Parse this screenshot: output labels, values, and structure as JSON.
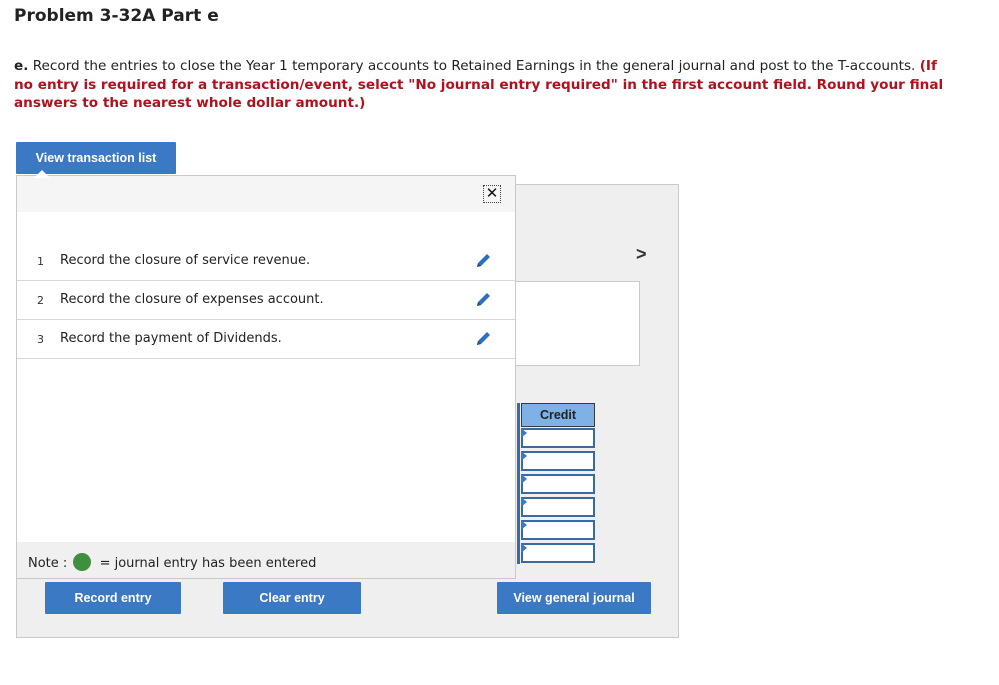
{
  "page": {
    "title": "Problem 3-32A Part e"
  },
  "instructions": {
    "lead": "e.",
    "text": "Record the entries to close the Year 1 temporary accounts to Retained Earnings in the general journal and post to the T-accounts.",
    "emphasis": "(If no entry is required for a transaction/event, select \"No journal entry required\" in the first account field. Round your final answers to the nearest whole dollar amount.)"
  },
  "buttons": {
    "view_transaction_list": "View transaction list",
    "record_entry": "Record entry",
    "clear_entry": "Clear entry",
    "view_general_journal": "View general journal"
  },
  "transactions": [
    {
      "number": "1",
      "label": "Record the closure of service revenue."
    },
    {
      "number": "2",
      "label": "Record the closure of expenses account."
    },
    {
      "number": "3",
      "label": "Record the payment of Dividends."
    }
  ],
  "journal": {
    "credit_header": "Credit",
    "next_arrow": ">"
  },
  "note": {
    "prefix": "Note :",
    "text": "= journal entry has been entered"
  },
  "icons": {
    "close": "close-icon",
    "edit": "pencil-icon",
    "next": "chevron-right-icon",
    "status": "green-dot-icon"
  },
  "colors": {
    "button": "#3b79c4",
    "emphasis": "#b3101e",
    "credit_header": "#7fb1e6",
    "entered_dot": "#3e8f3e"
  }
}
